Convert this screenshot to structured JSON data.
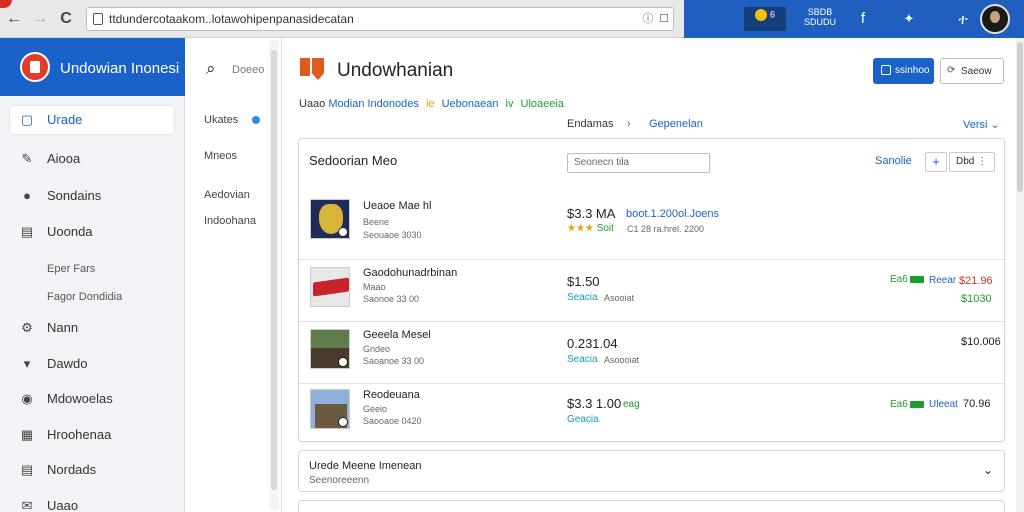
{
  "browser": {
    "back": "←",
    "forward": "→",
    "reload": "C",
    "url": "ttdundercotaakom..lotawohipenpanasidecatan",
    "ext1": "6",
    "ext2": "SBDB\nSDUDU",
    "ext3": "f",
    "ext4": "✦",
    "ext5": "ተ"
  },
  "sidebar": {
    "brand": "Undowian Inonesi",
    "items": [
      {
        "label": "Urade",
        "icon": "square-outline-icon",
        "glyph": "▢"
      },
      {
        "label": "Aiooa",
        "icon": "pencil-icon",
        "glyph": "✎"
      },
      {
        "label": "Sondains",
        "icon": "circle-dot-icon",
        "glyph": "●"
      },
      {
        "label": "Uoonda",
        "icon": "list-box-icon",
        "glyph": "▤"
      },
      {
        "label": "Nann",
        "icon": "gear-icon",
        "glyph": "⚙"
      },
      {
        "label": "Dawdo",
        "icon": "dropdown-box-icon",
        "glyph": "▾"
      },
      {
        "label": "Mdowoelas",
        "icon": "eye-icon",
        "glyph": "◉"
      },
      {
        "label": "Hroohenaa",
        "icon": "grid-box-icon",
        "glyph": "▦"
      },
      {
        "label": "Nordads",
        "icon": "document-icon",
        "glyph": "▤"
      },
      {
        "label": "Uaao",
        "icon": "mail-icon",
        "glyph": "✉"
      }
    ],
    "subitems": [
      "Eper Fars",
      "Fagor Dondidia"
    ]
  },
  "column2": {
    "search_placeholder": "Doeeo",
    "items": [
      "Ukates",
      "Mneos",
      "Aedovian",
      "Indoohana"
    ]
  },
  "main": {
    "title": "Undowhanian",
    "primary_button": "ssinhoo",
    "secondary_button": "Saeow",
    "crumb": {
      "part1": "Uaao",
      "part2": "Modian Indonodes",
      "sep": "ie",
      "part3": "Uebonaean",
      "sep2": "iv",
      "part4": "Uloaeeia"
    },
    "breadcrumb2": {
      "a": "Endamas",
      "arrow": "›",
      "b": "Gepenelan",
      "versi": "Versi ⌄"
    }
  },
  "panel": {
    "title": "Sedoorian Meo",
    "search_value": "Seonecn tila",
    "link": "Sanolie",
    "add": "+",
    "more": "Dbd ⋮",
    "rows": [
      {
        "name": "Ueaoe Mae hl",
        "sub1": "Beene",
        "sub2": "Seouaoe 3030",
        "price": "$3.3 MA",
        "price_extra": "boot.1.200ol.Joens",
        "stars": "★★★",
        "stars_label": "Soit",
        "under": "C1 28 ra.hrel. 2200"
      },
      {
        "name": "Gaodohunadrbinan",
        "sub1": "Maao",
        "sub2": "Saonoe 33 00",
        "price": "$1.50",
        "under_teal": "Seacia",
        "under": "Asooiat",
        "tag_label": "Ea6",
        "right_label": "Reear",
        "right_red": "$21.96",
        "right_green": "$1030"
      },
      {
        "name": "Geeela Mesel",
        "sub1": "Gndeo",
        "sub2": "Saoanoe 33 00",
        "price": "0.231.04",
        "under_teal": "Seacia",
        "under": "Asoooiat",
        "right_dark": "$10.006"
      },
      {
        "name": "Reodeuana",
        "sub1": "Geeio",
        "sub2": "Saooaoe 0420",
        "price": "$3.3 1.00",
        "price_tag": "eag",
        "under_teal": "Geacia",
        "tag_label": "Ea6",
        "right_label": "Uleeat",
        "right_dark": "70.96"
      }
    ]
  },
  "accordion": {
    "title": "Urede Meene Imenean",
    "sub": "Seenoreeenn",
    "chevron": "⌄"
  },
  "colors": {
    "brand_blue": "#1a62c9",
    "accent_orange": "#e05a1c",
    "green": "#1b9e2f",
    "red": "#c0392b"
  }
}
